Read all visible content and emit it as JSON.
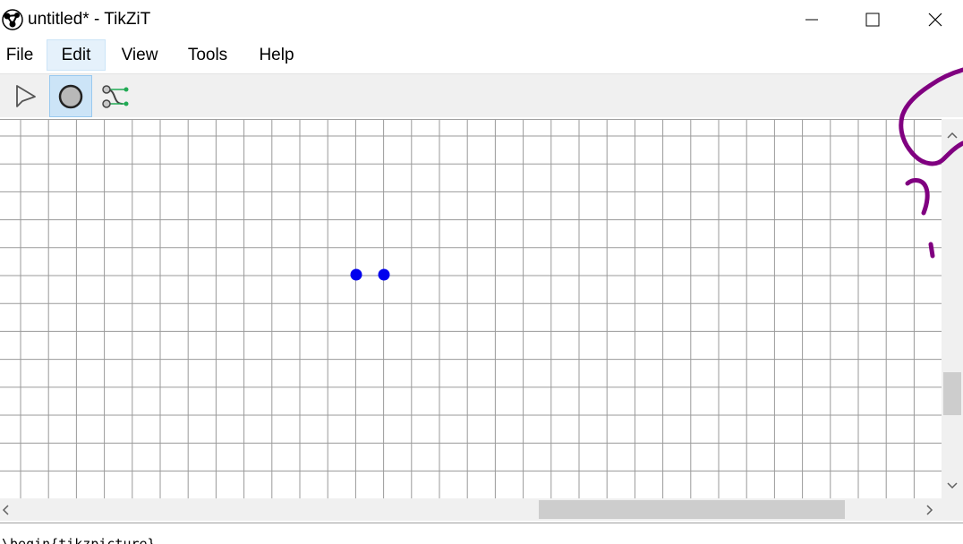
{
  "window": {
    "title": "untitled* - TikZiT"
  },
  "menu": {
    "items": [
      {
        "label": "File"
      },
      {
        "label": "Edit",
        "active": true
      },
      {
        "label": "View"
      },
      {
        "label": "Tools"
      },
      {
        "label": "Help"
      }
    ]
  },
  "toolbar": {
    "tools": [
      {
        "name": "select-tool",
        "icon": "pointer-arrow-icon"
      },
      {
        "name": "node-tool",
        "icon": "circle-icon",
        "active": true
      },
      {
        "name": "edge-tool",
        "icon": "edge-connect-icon"
      }
    ]
  },
  "canvas": {
    "grid_color": "#9a9a9a",
    "node_color": "#0000ee",
    "nodes": [
      {
        "id": "n1"
      },
      {
        "id": "n2"
      }
    ]
  },
  "code": {
    "text": "\\begin{tikzpicture}"
  },
  "colors": {
    "ink": "#800080",
    "active_menu": "#e5f1fb",
    "active_tool": "#cce4f7"
  }
}
